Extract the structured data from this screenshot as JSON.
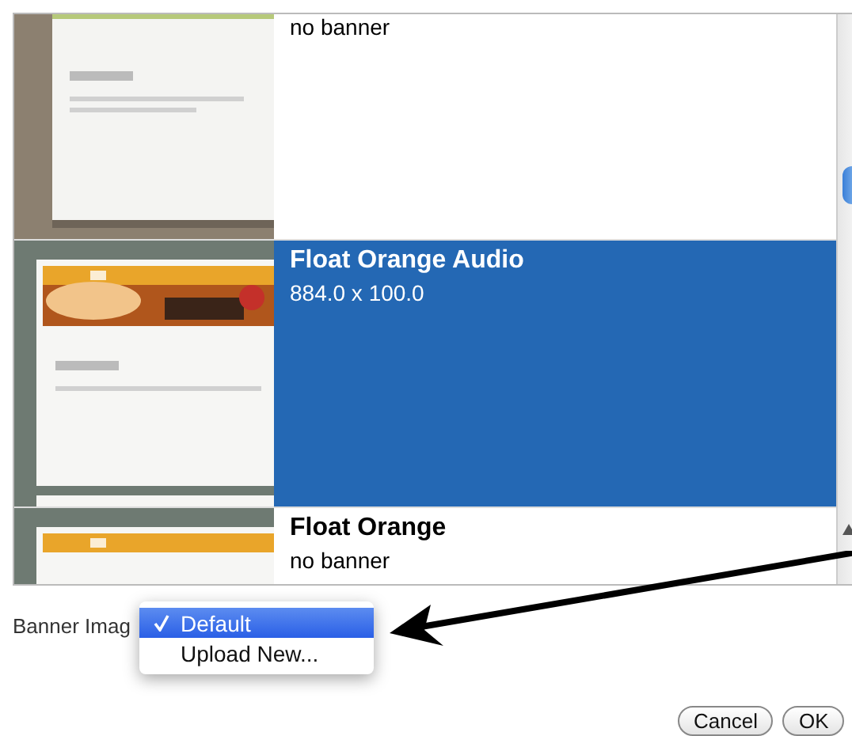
{
  "banner_list": {
    "items": [
      {
        "kind": "picture",
        "size": "no banner",
        "selected": false
      },
      {
        "kind": "picture",
        "name": "Float Orange Audio",
        "size": "884.0 x 100.0",
        "selected": true
      },
      {
        "kind": "picture",
        "name": "Float Orange",
        "size": "no banner",
        "selected": false
      }
    ]
  },
  "banner_image": {
    "label": "Banner Imag",
    "menu": [
      {
        "label": "Default",
        "selected": true
      },
      {
        "label": "Upload New...",
        "selected": false
      }
    ]
  },
  "buttons": [
    "Cancel",
    "OK"
  ]
}
